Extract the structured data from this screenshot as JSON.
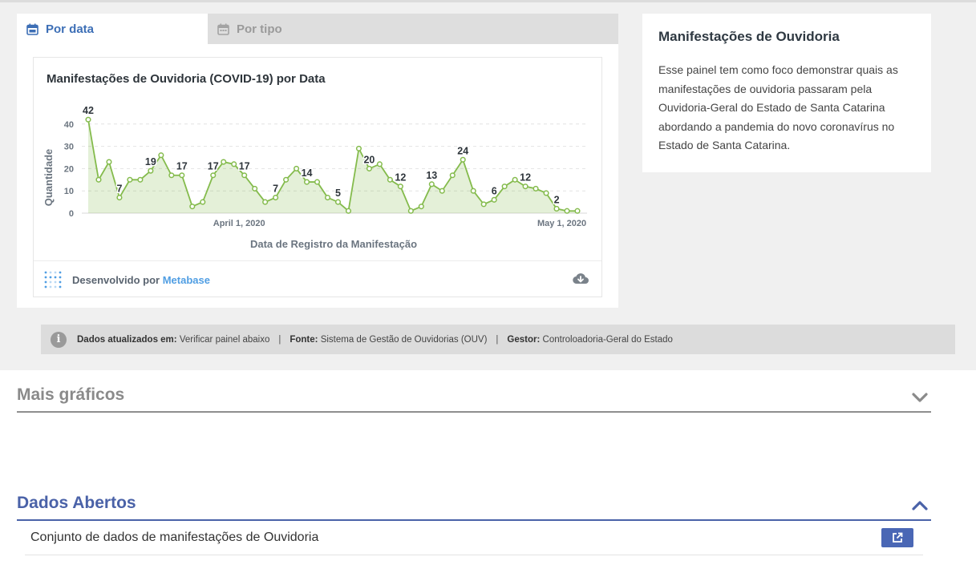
{
  "tabs": {
    "by_date": "Por data",
    "by_type": "Por tipo"
  },
  "chart_card": {
    "title": "Manifestações de Ouvidoria (COVID-19) por Data",
    "footer_prefix": "Desenvolvido por",
    "footer_link": "Metabase"
  },
  "chart_data": {
    "type": "line",
    "title": "Manifestações de Ouvidoria (COVID-19) por Data",
    "xlabel": "Data de Registro da Manifestação",
    "ylabel": "Quantidade",
    "x_tick_labels": [
      "April 1, 2020",
      "May 1, 2020"
    ],
    "y_ticks": [
      0,
      10,
      20,
      30,
      40
    ],
    "ylim": [
      0,
      44
    ],
    "grid": true,
    "color": "#84bb4c",
    "values": [
      42,
      15,
      23,
      7,
      15,
      15,
      19,
      26,
      17,
      17,
      3,
      5,
      17,
      23,
      22,
      17,
      11,
      5,
      7,
      15,
      20,
      14,
      14,
      7,
      5,
      1,
      29,
      20,
      22,
      15,
      12,
      1,
      3,
      13,
      10,
      17,
      24,
      10,
      4,
      6,
      12,
      15,
      12,
      11,
      9,
      2,
      1,
      1
    ],
    "point_labels": [
      {
        "index": 0,
        "text": "42"
      },
      {
        "index": 3,
        "text": "7"
      },
      {
        "index": 6,
        "text": "19"
      },
      {
        "index": 9,
        "text": "17"
      },
      {
        "index": 12,
        "text": "17"
      },
      {
        "index": 15,
        "text": "17"
      },
      {
        "index": 18,
        "text": "7"
      },
      {
        "index": 21,
        "text": "14"
      },
      {
        "index": 24,
        "text": "5"
      },
      {
        "index": 27,
        "text": "20"
      },
      {
        "index": 30,
        "text": "12"
      },
      {
        "index": 33,
        "text": "13"
      },
      {
        "index": 36,
        "text": "24"
      },
      {
        "index": 39,
        "text": "6"
      },
      {
        "index": 42,
        "text": "12"
      },
      {
        "index": 45,
        "text": "2"
      }
    ]
  },
  "description": {
    "title": "Manifestações de Ouvidoria",
    "text": "Esse painel tem como foco demonstrar quais as manifestações de ouvidoria passaram pela Ouvidoria-Geral do Estado de Santa Catarina abordando a pandemia do novo coronavírus no Estado de Santa Catarina."
  },
  "info_bar": {
    "updated_label": "Dados atualizados em:",
    "updated_value": "Verificar painel abaixo",
    "source_label": "Fonte:",
    "source_value": "Sistema de Gestão de Ouvidorias (OUV)",
    "manager_label": "Gestor:",
    "manager_value": "Controloadoria-Geral do Estado",
    "separator": "|"
  },
  "sections": {
    "more_charts": "Mais gráficos",
    "open_data": "Dados Abertos"
  },
  "open_data_items": [
    {
      "label": "Conjunto de dados de manifestações de Ouvidoria"
    }
  ],
  "icons": {
    "tab_calendar": "calendar-icon",
    "info": "info-icon",
    "download": "download-cloud-icon",
    "external": "external-link-icon",
    "chevron_down": "chevron-down-icon",
    "chevron_up": "chevron-up-icon"
  },
  "colors": {
    "accent": "#3d6fb6",
    "section_blue": "#4a62a8",
    "line": "#84bb4c"
  }
}
